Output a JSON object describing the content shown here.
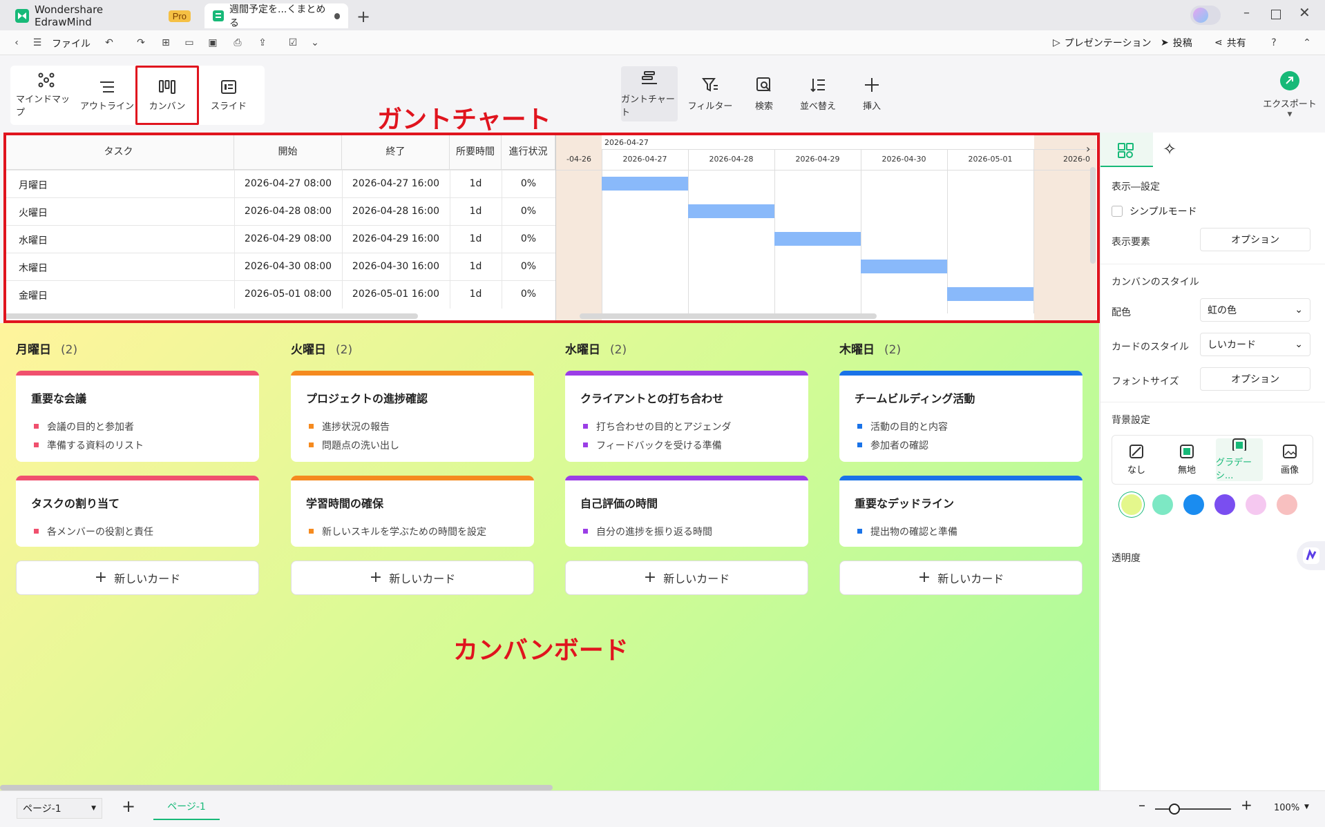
{
  "titlebar": {
    "app_name": "Wondershare EdrawMind",
    "pro_badge": "Pro",
    "doc_tab": "週間予定を...くまとめる"
  },
  "toolbar": {
    "file_label": "ファイル",
    "presentation_label": "プレゼンテーション",
    "post_label": "投稿",
    "share_label": "共有"
  },
  "view_modes": [
    {
      "label": "マインドマップ",
      "icon": "mindmap-icon"
    },
    {
      "label": "アウトライン",
      "icon": "outline-icon"
    },
    {
      "label": "カンバン",
      "icon": "kanban-icon",
      "selected": true
    },
    {
      "label": "スライド",
      "icon": "slide-icon"
    }
  ],
  "tools": {
    "gantt": "ガントチャート",
    "filter": "フィルター",
    "search": "検索",
    "sort": "並べ替え",
    "insert": "挿入",
    "export": "エクスポート"
  },
  "annotations": {
    "gantt_title": "ガントチャート",
    "kanban_title": "カンバンボード",
    "highlight_color": "#e0141e"
  },
  "gantt": {
    "headers": {
      "task": "タスク",
      "start": "開始",
      "end": "終了",
      "duration": "所要時間",
      "progress": "進行状況"
    },
    "timeline_top": "2026-04-27",
    "dates": [
      "-04-26",
      "2026-04-27",
      "2026-04-28",
      "2026-04-29",
      "2026-04-30",
      "2026-05-01",
      "2026-0"
    ],
    "bar_color": "#89b9fa",
    "rows": [
      {
        "task": "月曜日",
        "start": "2026-04-27 08:00",
        "end": "2026-04-27 16:00",
        "duration": "1d",
        "progress": "0%",
        "day_index": 1
      },
      {
        "task": "火曜日",
        "start": "2026-04-28 08:00",
        "end": "2026-04-28 16:00",
        "duration": "1d",
        "progress": "0%",
        "day_index": 2
      },
      {
        "task": "水曜日",
        "start": "2026-04-29 08:00",
        "end": "2026-04-29 16:00",
        "duration": "1d",
        "progress": "0%",
        "day_index": 3
      },
      {
        "task": "木曜日",
        "start": "2026-04-30 08:00",
        "end": "2026-04-30 16:00",
        "duration": "1d",
        "progress": "0%",
        "day_index": 4
      },
      {
        "task": "金曜日",
        "start": "2026-05-01 08:00",
        "end": "2026-05-01 16:00",
        "duration": "1d",
        "progress": "0%",
        "day_index": 5
      }
    ]
  },
  "kanban": {
    "new_card_label": "新しいカード",
    "columns": [
      {
        "title": "月曜日",
        "count": "(2)",
        "color": "#f0506e",
        "cards": [
          {
            "title": "重要な会議",
            "items": [
              "会議の目的と参加者",
              "準備する資料のリスト"
            ]
          },
          {
            "title": "タスクの割り当て",
            "items": [
              "各メンバーの役割と責任"
            ]
          }
        ]
      },
      {
        "title": "火曜日",
        "count": "(2)",
        "color": "#f58a1f",
        "cards": [
          {
            "title": "プロジェクトの進捗確認",
            "items": [
              "進捗状況の報告",
              "問題点の洗い出し"
            ]
          },
          {
            "title": "学習時間の確保",
            "items": [
              "新しいスキルを学ぶための時間を設定"
            ]
          }
        ]
      },
      {
        "title": "水曜日",
        "count": "(2)",
        "color": "#9b3ee6",
        "cards": [
          {
            "title": "クライアントとの打ち合わせ",
            "items": [
              "打ち合わせの目的とアジェンダ",
              "フィードバックを受ける準備"
            ]
          },
          {
            "title": "自己評価の時間",
            "items": [
              "自分の進捗を振り返る時間"
            ]
          }
        ]
      },
      {
        "title": "木曜日",
        "count": "(2)",
        "color": "#1a73e8",
        "cards": [
          {
            "title": "チームビルディング活動",
            "items": [
              "活動の目的と内容",
              "参加者の確認"
            ]
          },
          {
            "title": "重要なデッドライン",
            "items": [
              "提出物の確認と準備"
            ]
          }
        ]
      }
    ]
  },
  "panel": {
    "display_settings": "表示―設定",
    "simple_mode": "シンプルモード",
    "display_elements": "表示要素",
    "option": "オプション",
    "kanban_style": "カンバンのスタイル",
    "color_scheme": "配色",
    "color_scheme_value": "虹の色",
    "card_style": "カードのスタイル",
    "card_style_value": "しいカード",
    "font_size": "フォントサイズ",
    "bg_settings": "背景設定",
    "bg_options": [
      "なし",
      "無地",
      "グラデーシ...",
      "画像"
    ],
    "swatches": [
      "#e4f78c",
      "#7de8c4",
      "#1a8cf0",
      "#7a4ef0",
      "#f5c8f0",
      "#f8c0c0"
    ],
    "transparency": "透明度"
  },
  "footer": {
    "page_select": "ページ-1",
    "page_tab": "ページ-1",
    "zoom": "100%"
  }
}
